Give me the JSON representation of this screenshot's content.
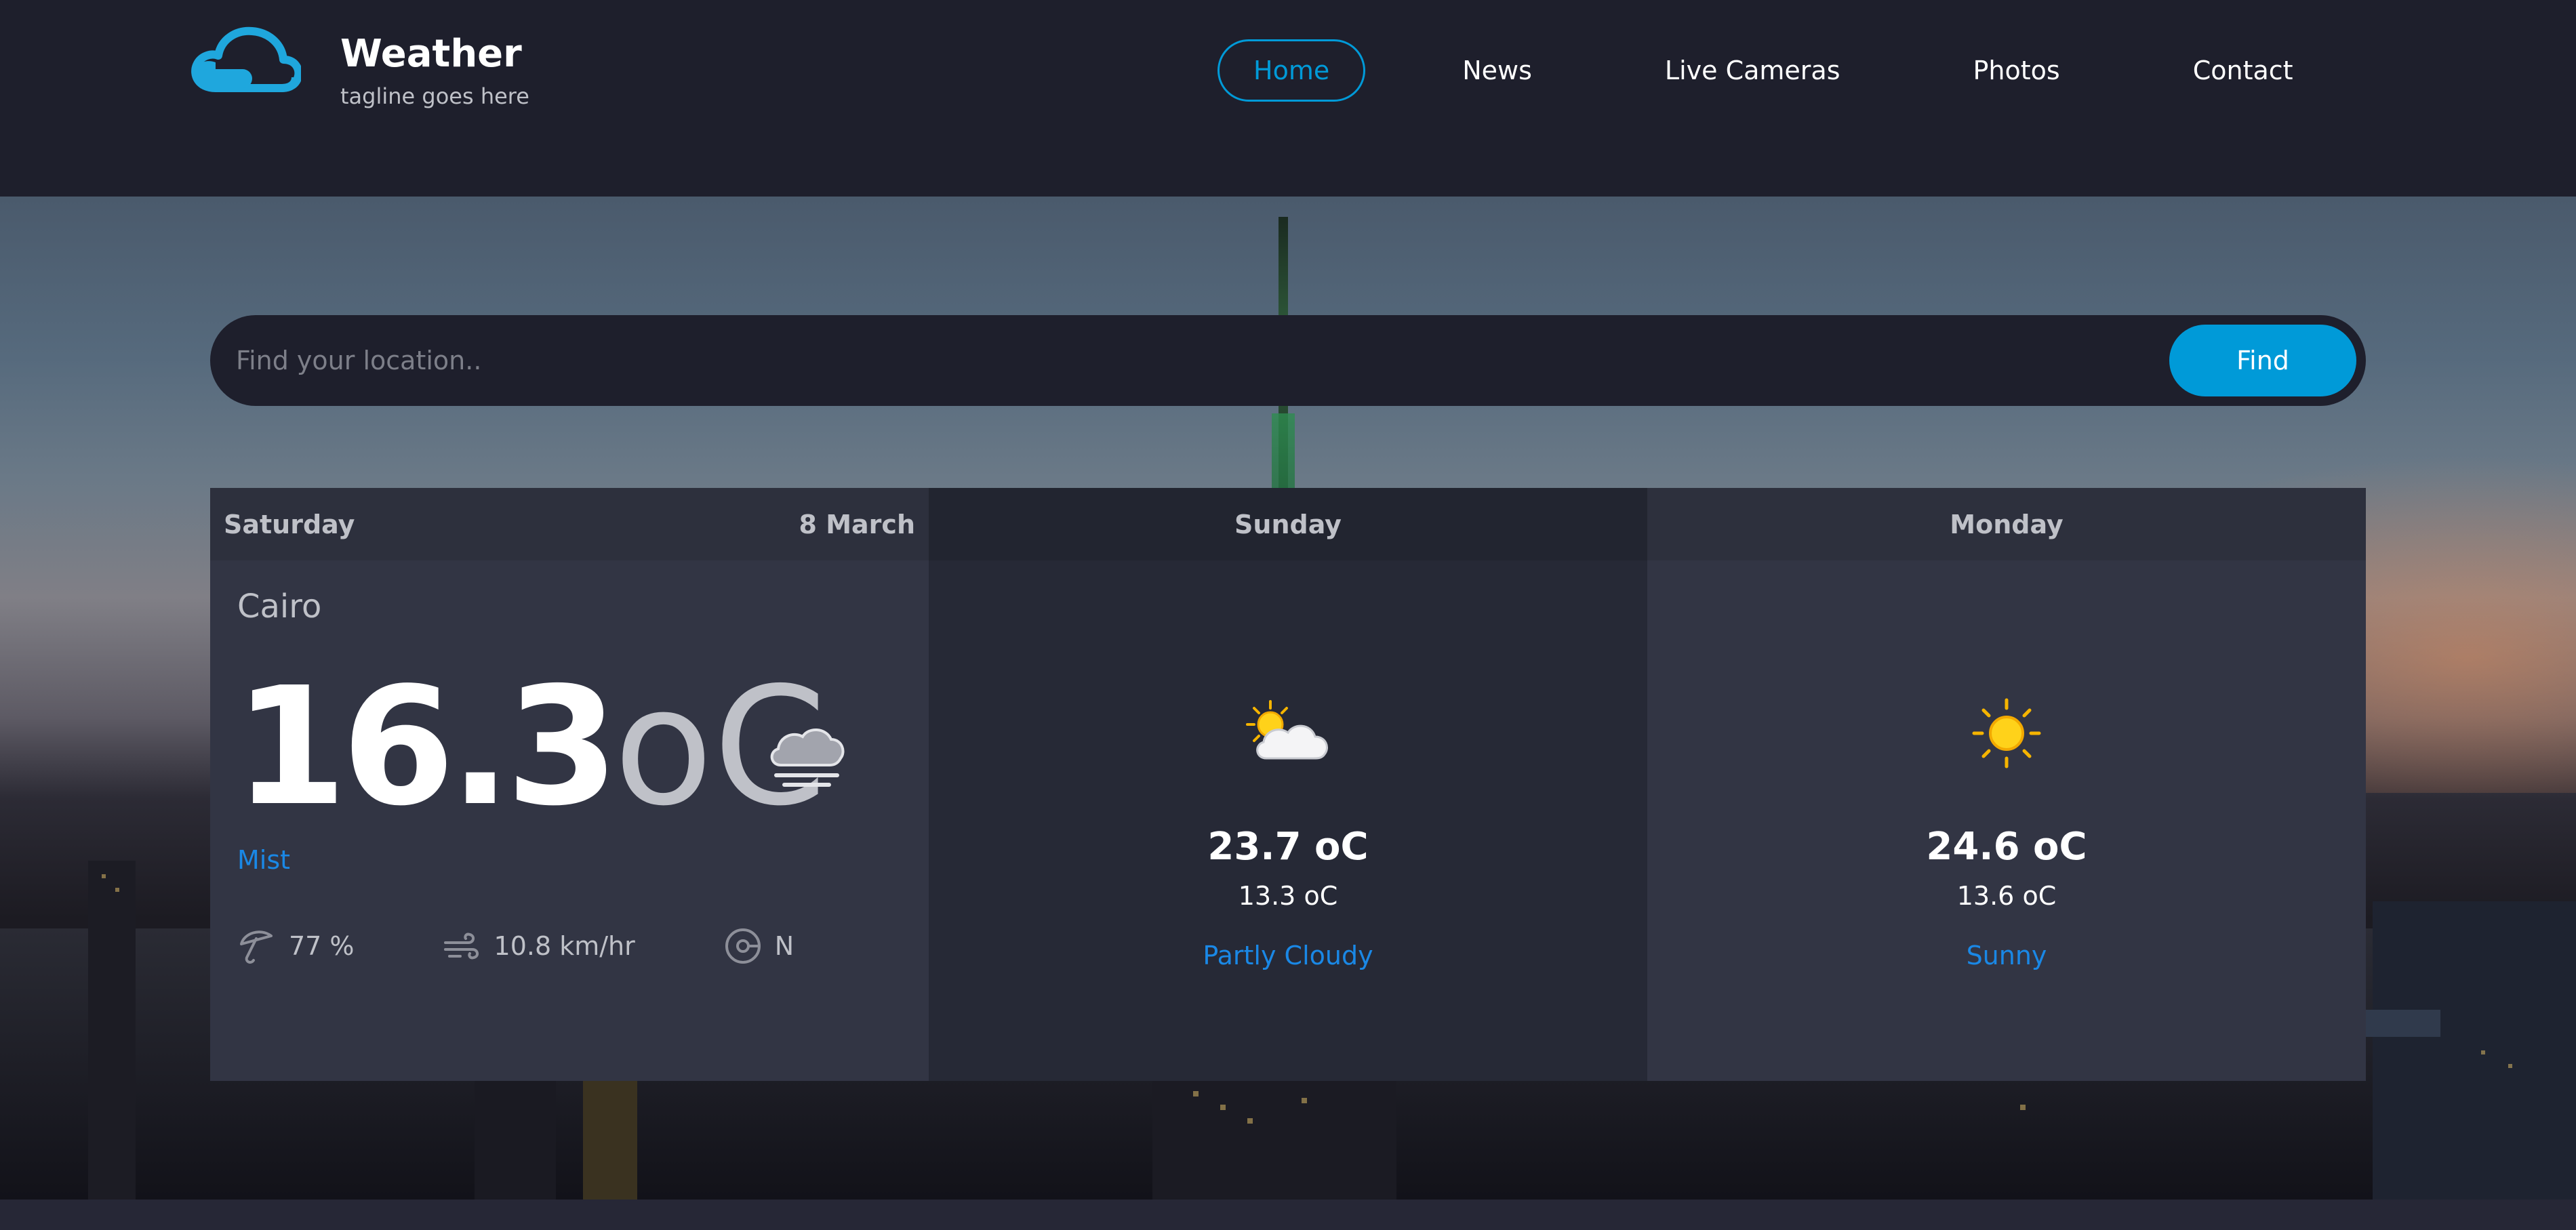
{
  "brand": {
    "title": "Weather",
    "tagline": "tagline goes here",
    "logo_icon": "cloud-icon",
    "logo_color": "#1fa7dd"
  },
  "nav": {
    "items": [
      {
        "label": "Home",
        "active": true
      },
      {
        "label": "News",
        "active": false
      },
      {
        "label": "Live Cameras",
        "active": false
      },
      {
        "label": "Photos",
        "active": false
      },
      {
        "label": "Contact",
        "active": false
      }
    ]
  },
  "search": {
    "placeholder": "Find your location..",
    "value": "",
    "button_label": "Find"
  },
  "today": {
    "day": "Saturday",
    "date": "8 March",
    "city": "Cairo",
    "temperature": "16.3",
    "unit": "oC",
    "icon": "mist-icon",
    "description": "Mist",
    "humidity": "77 %",
    "wind_speed": "10.8 km/hr",
    "wind_direction": "N"
  },
  "forecast": [
    {
      "day": "Sunday",
      "icon": "partly-cloudy-icon",
      "max_temp": "23.7 oC",
      "min_temp": "13.3 oC",
      "description": "Partly Cloudy"
    },
    {
      "day": "Monday",
      "icon": "sun-icon",
      "max_temp": "24.6 oC",
      "min_temp": "13.6 oC",
      "description": "Sunny"
    }
  ],
  "colors": {
    "accent": "#009ad8",
    "link": "#1a88e6",
    "background": "#1e1f2c"
  }
}
